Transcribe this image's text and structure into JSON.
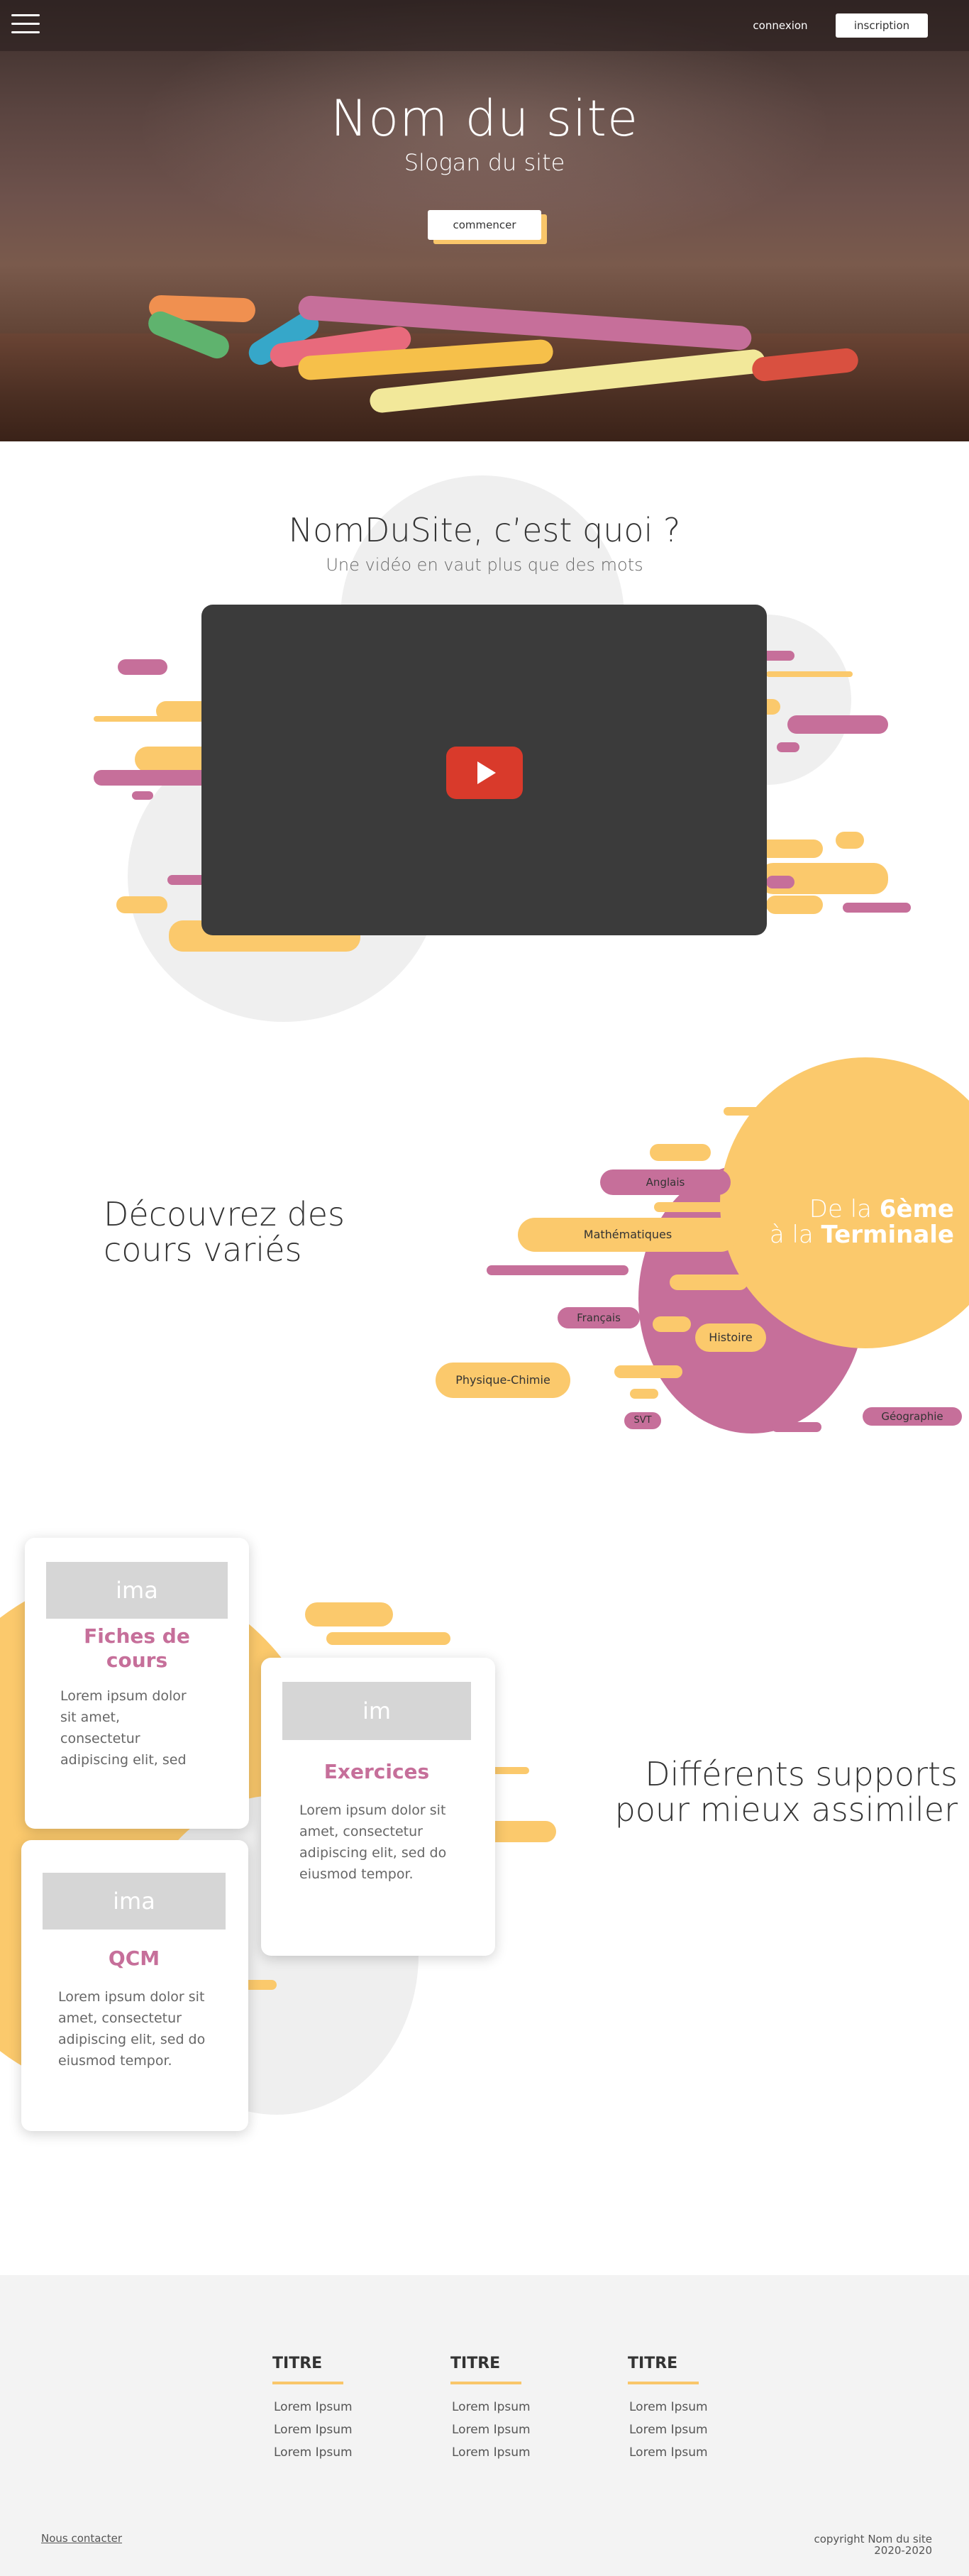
{
  "nav": {
    "login_label": "connexion",
    "signup_label": "inscription"
  },
  "hero": {
    "title": "Nom du site",
    "slogan": "Slogan du site",
    "start_label": "commencer"
  },
  "about": {
    "title": "NomDuSite, c’est quoi ?",
    "subtitle": "Une vidéo en vaut plus que des mots"
  },
  "courses": {
    "title_line1": "Découvrez des",
    "title_line2": "cours variés",
    "circle_prefix1": "De la ",
    "circle_bold1": "6ème",
    "circle_prefix2": "à la ",
    "circle_bold2": "Terminale",
    "subjects": {
      "anglais": "Anglais",
      "maths": "Mathématiques",
      "francais": "Français",
      "histoire": "Histoire",
      "physique": "Physique-Chimie",
      "svt": "SVT",
      "geographie": "Géographie"
    }
  },
  "supports": {
    "title_line1": "Différents supports",
    "title_line2": "pour mieux assimiler",
    "cards": [
      {
        "img": "ima",
        "title": "Fiches de cours",
        "text": "Lorem ipsum dolor sit amet, consectetur adipiscing elit, sed do eiusmod tempor."
      },
      {
        "img": "im",
        "title": "Exercices",
        "text": "Lorem ipsum dolor sit amet, consectetur adipiscing elit, sed do eiusmod tempor."
      },
      {
        "img": "ima",
        "title": "QCM",
        "text": "Lorem ipsum dolor sit amet, consectetur adipiscing elit, sed do eiusmod tempor."
      }
    ]
  },
  "footer": {
    "columns": [
      {
        "title": "TITRE",
        "items": [
          "Lorem Ipsum",
          "Lorem Ipsum",
          "Lorem Ipsum"
        ]
      },
      {
        "title": "TITRE",
        "items": [
          "Lorem Ipsum",
          "Lorem Ipsum",
          "Lorem Ipsum"
        ]
      },
      {
        "title": "TITRE",
        "items": [
          "Lorem Ipsum",
          "Lorem Ipsum",
          "Lorem Ipsum"
        ]
      }
    ],
    "contact_label": "Nous contacter",
    "copyright_line1": "copyright Nom du site",
    "copyright_line2": "2020-2020"
  },
  "colors": {
    "accent_yellow": "#fbc96c",
    "accent_pink": "#c66f9a",
    "video_bg": "#3b3b3b",
    "play_red": "#d93a2b"
  },
  "icons": [
    "menu-icon",
    "youtube-play-icon"
  ]
}
